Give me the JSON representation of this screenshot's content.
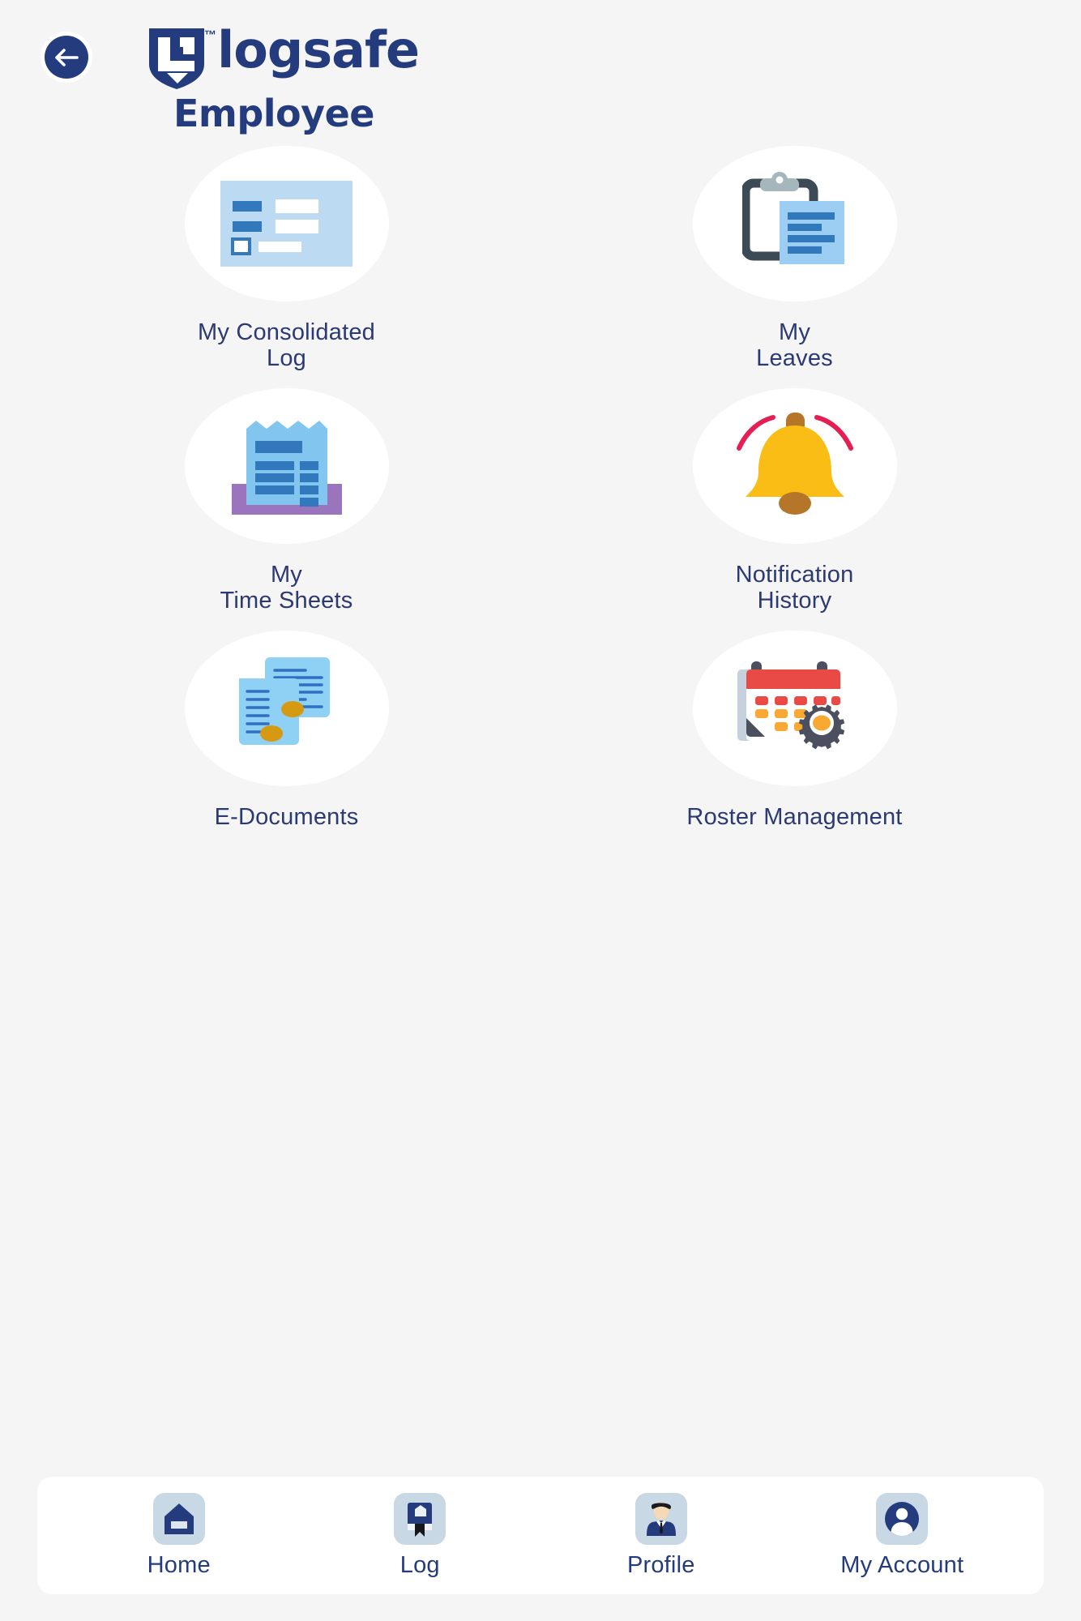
{
  "header": {
    "back_label": "Back",
    "back_icon": "arrow-left-icon",
    "brand_name": "logsafe",
    "brand_trademark": "™",
    "brand_subtitle": "Employee"
  },
  "colors": {
    "brand_navy": "#243c7e",
    "label_navy": "#2c3a73",
    "page_bg": "#f5f5f5",
    "bubble_white": "#ffffff",
    "nav_icon_bg": "#c8d8e4",
    "icon_light_blue": "#aed4f2",
    "icon_blue": "#3b7ec4",
    "icon_purple": "#9a74bd",
    "icon_gold": "#f7b917",
    "icon_brown": "#b5762a",
    "icon_crimson": "#e51f52",
    "icon_red": "#ea4a45",
    "icon_orange": "#f9a832",
    "icon_gray": "#4b4f5e"
  },
  "main": {
    "tiles": [
      {
        "label": "My Consolidated\nLog",
        "icon": "consolidated-log-icon"
      },
      {
        "label": "My\nLeaves",
        "icon": "clipboard-leaves-icon"
      },
      {
        "label": "My\nTime Sheets",
        "icon": "timesheet-receipt-icon"
      },
      {
        "label": "Notification\nHistory",
        "icon": "bell-icon"
      },
      {
        "label": "E-Documents",
        "icon": "documents-icon"
      },
      {
        "label": "Roster Management",
        "icon": "calendar-gear-icon"
      }
    ]
  },
  "bottom_nav": {
    "items": [
      {
        "label": "Home",
        "icon": "home-icon"
      },
      {
        "label": "Log",
        "icon": "book-bookmark-icon"
      },
      {
        "label": "Profile",
        "icon": "person-avatar-icon"
      },
      {
        "label": "My Account",
        "icon": "account-circle-icon"
      }
    ]
  }
}
